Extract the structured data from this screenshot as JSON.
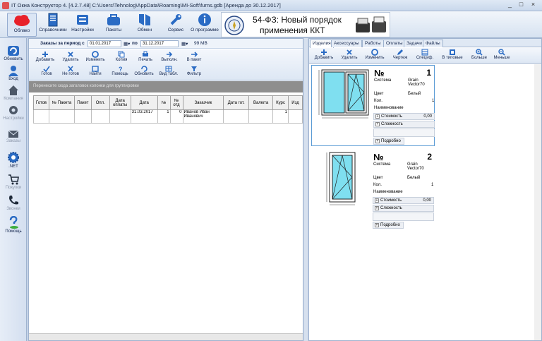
{
  "window": {
    "title": "IT Окна Конструктор 4. [4.2.7.48] C:\\Users\\Tehnolog\\AppData\\Roaming\\MI-Soft\\furns.gdb [Аренда до 30.12.2017]",
    "controls": [
      "_",
      "□",
      "×"
    ]
  },
  "main_toolbar": [
    {
      "label": "Облако",
      "icon": "cloud-icon"
    },
    {
      "label": "Справочники",
      "icon": "book-icon"
    },
    {
      "label": "Настройки",
      "icon": "settings-icon"
    },
    {
      "label": "Пакеты",
      "icon": "package-icon"
    },
    {
      "label": "Обмен",
      "icon": "exchange-icon"
    },
    {
      "label": "Сервис",
      "icon": "tools-icon"
    },
    {
      "label": "О программе",
      "icon": "info-icon"
    }
  ],
  "banner": {
    "line1": "54-ФЗ: Новый порядок",
    "line2": "применения ККТ"
  },
  "sidebar": [
    {
      "label": "Обновить",
      "icon": "refresh-icon",
      "enabled": true
    },
    {
      "label": "Вход",
      "icon": "user-icon",
      "enabled": true
    },
    {
      "label": "Компания",
      "icon": "company-icon",
      "enabled": false
    },
    {
      "label": "Настройки",
      "icon": "gear-icon",
      "enabled": false
    },
    {
      "label": "Заказы",
      "icon": "mail-icon",
      "enabled": false
    },
    {
      "label": ".NET",
      "icon": "net-gear-icon",
      "enabled": true
    },
    {
      "label": "Покупки",
      "icon": "cart-icon",
      "enabled": false
    },
    {
      "label": "Звонки",
      "icon": "phone-icon",
      "enabled": false
    },
    {
      "label": "Помощь",
      "icon": "help-icon",
      "enabled": true
    }
  ],
  "period": {
    "label": "Заказы за период с",
    "from": "01.01.2017",
    "to_label": "по",
    "to": "31.12.2017",
    "size": "99 MB"
  },
  "actions_row1": [
    {
      "label": "Добавить",
      "icon": "add-icon"
    },
    {
      "label": "Удалить",
      "icon": "delete-icon"
    },
    {
      "label": "Изменить",
      "icon": "edit-icon"
    },
    {
      "label": "Копия",
      "icon": "copy-icon"
    },
    {
      "label": "Печать",
      "icon": "print-icon"
    },
    {
      "label": "Выполн.",
      "icon": "done-icon"
    },
    {
      "label": "В пакет",
      "icon": "to-package-icon"
    }
  ],
  "actions_row2": [
    {
      "label": "Готов",
      "icon": "check-icon"
    },
    {
      "label": "Не готов",
      "icon": "uncheck-icon"
    },
    {
      "label": "Найти",
      "icon": "find-icon"
    },
    {
      "label": "Помощь",
      "icon": "help-small-icon"
    },
    {
      "label": "Обновить",
      "icon": "refresh-small-icon"
    },
    {
      "label": "Вид табл.",
      "icon": "table-view-icon"
    },
    {
      "label": "Фильтр",
      "icon": "filter-icon"
    }
  ],
  "group_hint": "Перенесите сюда заголовок колонки для группировки",
  "grid": {
    "columns": [
      "Готов",
      "№ Пакета",
      "Пакет",
      "Опл.",
      "Дата оплаты",
      "Дата",
      "№",
      "№ отд",
      "Заказчик",
      "Дата гот.",
      "Валюта",
      "Курс",
      "Изд"
    ],
    "rows": [
      [
        "",
        "",
        "",
        "",
        "",
        "31.03.2017",
        "1",
        "0",
        "Иванов Иван Иванович",
        "",
        "",
        "1",
        ""
      ]
    ]
  },
  "right_tabs": [
    "Изделия",
    "Аксессуары",
    "Работы",
    "Оплаты",
    "Задачи",
    "Файлы"
  ],
  "right_toolbar": [
    {
      "label": "Добавить",
      "icon": "add-icon"
    },
    {
      "label": "Удалить",
      "icon": "delete-icon"
    },
    {
      "label": "Изменить",
      "icon": "edit-icon"
    },
    {
      "label": "Чертеж",
      "icon": "pencil-icon"
    },
    {
      "label": "Специф.",
      "icon": "spec-icon"
    },
    {
      "label": "В типовые",
      "icon": "typical-icon"
    },
    {
      "label": "Больше",
      "icon": "zoom-in-icon"
    },
    {
      "label": "Меньше",
      "icon": "zoom-out-icon"
    }
  ],
  "products": [
    {
      "num_label": "№",
      "index": "1",
      "props": [
        {
          "k": "Система",
          "v": "Grain Vector70"
        },
        {
          "k": "Цвет",
          "v": "Белый"
        },
        {
          "k": "Кол.",
          "v": "1"
        },
        {
          "k": "Наименование",
          "v": ""
        }
      ],
      "cost_label": "Стоимость",
      "cost": "0,00",
      "complexity_label": "Сложность",
      "details_label": "Подробно",
      "selected": true
    },
    {
      "num_label": "№",
      "index": "2",
      "props": [
        {
          "k": "Система",
          "v": "Grain Vector70"
        },
        {
          "k": "Цвет",
          "v": "Белый"
        },
        {
          "k": "Кол.",
          "v": "1"
        },
        {
          "k": "Наименование",
          "v": ""
        }
      ],
      "cost_label": "Стоимость",
      "cost": "0,00",
      "complexity_label": "Сложность",
      "details_label": "Подробно",
      "selected": false
    }
  ]
}
